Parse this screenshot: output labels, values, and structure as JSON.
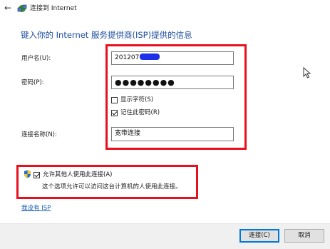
{
  "window": {
    "title": "连接到 Internet",
    "back_icon": "back-arrow-icon",
    "app_icon": "network-connect-icon"
  },
  "form": {
    "heading": "键入你的 Internet 服务提供商(ISP)提供的信息",
    "username_label": "用户名(U):",
    "username_value": "201207",
    "password_label": "密码(P):",
    "password_value": "●●●●●●●●",
    "show_chars_label": "显示字符(S)",
    "show_chars_checked": false,
    "remember_label": "记住此密码(R)",
    "remember_checked": true,
    "conn_name_label": "连接名称(N):",
    "conn_name_value": "宽带连接"
  },
  "sharing": {
    "allow_label": "允许其他人使用此连接(A)",
    "allow_checked": true,
    "allow_desc": "这个选项允许可以访问这台计算机的人使用此连接。",
    "shield_icon": "uac-shield-icon"
  },
  "links": {
    "no_isp": "我没有 ISP"
  },
  "buttons": {
    "connect": "连接(C)",
    "cancel": "取消"
  },
  "colors": {
    "heading": "#1b4b9c",
    "highlight_box": "#e8101c",
    "link": "#1a5fb4",
    "redaction": "#1f2ee8"
  }
}
